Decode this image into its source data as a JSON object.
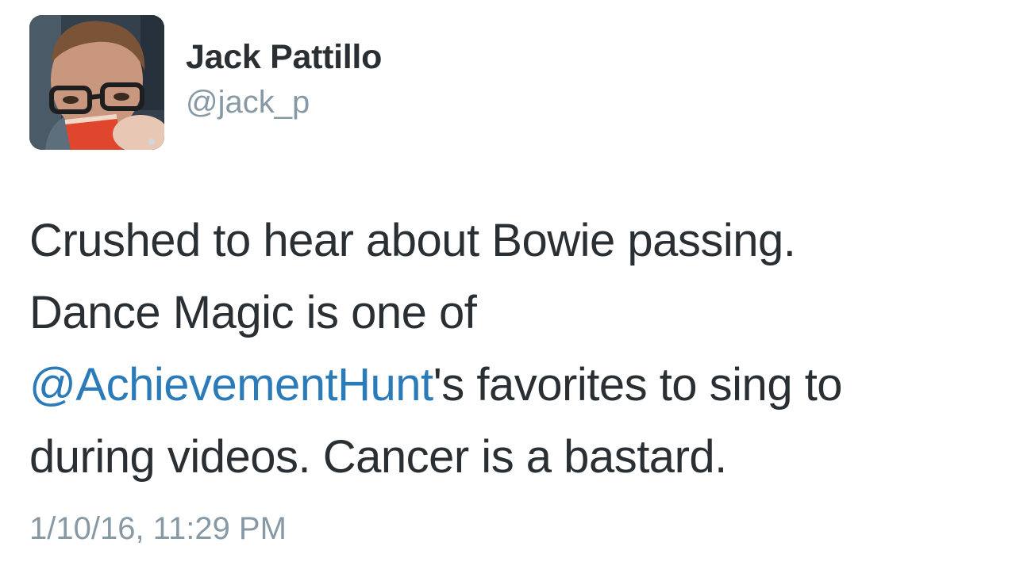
{
  "author": {
    "name": "Jack Pattillo",
    "handle": "@jack_p"
  },
  "tweet": {
    "line1": "Crushed to hear about Bowie passing.",
    "line2": "Dance Magic is one of",
    "mention": "@AchievementHunt",
    "line3_rest": "'s favorites to sing to",
    "line4": "during videos. Cancer is a bastard."
  },
  "timestamp": "1/10/16, 11:29 PM",
  "colors": {
    "text": "#292f33",
    "secondary": "#8899a6",
    "link": "#2b7bb9"
  }
}
